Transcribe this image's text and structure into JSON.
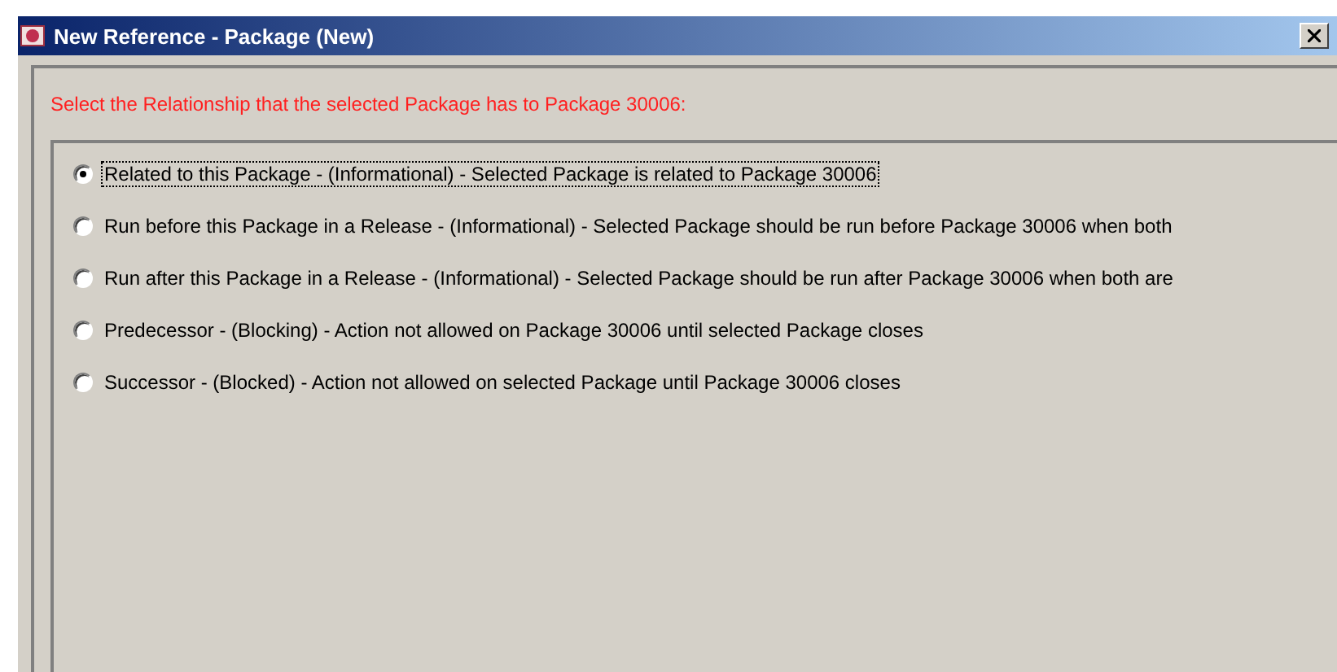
{
  "window": {
    "title": "New Reference - Package (New)"
  },
  "instruction": "Select the Relationship that the selected Package has to Package 30006:",
  "options": [
    {
      "label": "Related to this Package - (Informational) - Selected Package is related to Package 30006",
      "selected": true
    },
    {
      "label": "Run before this Package in a Release - (Informational) - Selected Package should be run before Package 30006 when both",
      "selected": false
    },
    {
      "label": "Run after this Package in a Release - (Informational) - Selected Package should be run after Package 30006 when both are",
      "selected": false
    },
    {
      "label": "Predecessor - (Blocking) - Action not allowed on Package 30006 until selected Package closes",
      "selected": false
    },
    {
      "label": "Successor - (Blocked) - Action not allowed on selected Package until Package 30006 closes",
      "selected": false
    }
  ]
}
